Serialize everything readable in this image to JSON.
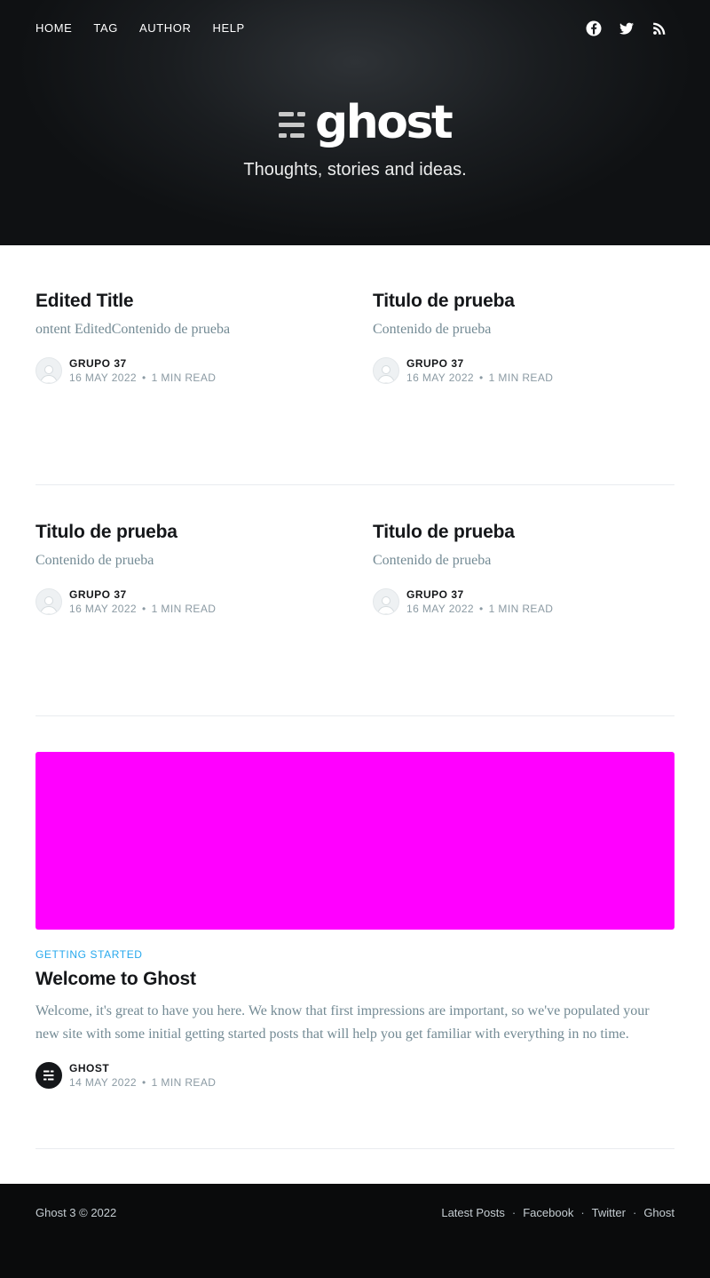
{
  "nav": {
    "items": [
      "HOME",
      "TAG",
      "AUTHOR",
      "HELP"
    ]
  },
  "social": {
    "icons": [
      "facebook-icon",
      "twitter-icon",
      "rss-icon"
    ]
  },
  "hero": {
    "logo_text": "ghost",
    "tagline": "Thoughts, stories and ideas."
  },
  "posts": [
    {
      "title": "Edited Title",
      "excerpt": "ontent EditedContenido de prueba",
      "author": "GRUPO 37",
      "date": "16 MAY 2022",
      "read_time": "1 MIN READ"
    },
    {
      "title": "Titulo de prueba",
      "excerpt": "Contenido de prueba",
      "author": "GRUPO 37",
      "date": "16 MAY 2022",
      "read_time": "1 MIN READ"
    },
    {
      "title": "Titulo de prueba",
      "excerpt": "Contenido de prueba",
      "author": "GRUPO 37",
      "date": "16 MAY 2022",
      "read_time": "1 MIN READ"
    },
    {
      "title": "Titulo de prueba",
      "excerpt": "Contenido de prueba",
      "author": "GRUPO 37",
      "date": "16 MAY 2022",
      "read_time": "1 MIN READ"
    }
  ],
  "featured": {
    "image_color": "#ff00ff",
    "tag": "GETTING STARTED",
    "title": "Welcome to Ghost",
    "excerpt": "Welcome, it's great to have you here. We know that first impressions are important, so we've populated your new site with some initial getting started posts that will help you get familiar with everything in no time.",
    "author": "GHOST",
    "date": "14 MAY 2022",
    "read_time": "1 MIN READ"
  },
  "footer": {
    "copyright": "Ghost 3 © 2022",
    "links": [
      "Latest Posts",
      "Facebook",
      "Twitter",
      "Ghost"
    ],
    "separator": "·"
  },
  "meta_separator": "•",
  "colors": {
    "accent": "#26a8ed",
    "hero_dark": "#15171a",
    "footer_bg": "#0a0b0c"
  }
}
